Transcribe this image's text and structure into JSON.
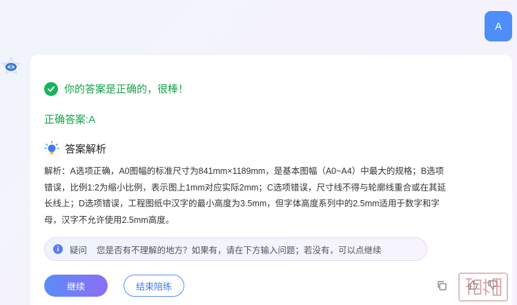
{
  "user": {
    "avatar_letter": "A",
    "accent": "#4d8ef8"
  },
  "result": {
    "message": "你的答案是正确的，很棒！",
    "correct_answer": "正确答案:A",
    "color": "#16a34a"
  },
  "analysis": {
    "title": "答案解析",
    "lines": [
      "解析：A选项正确，A0图幅的标准尺寸为841mm×1189mm，是基本图幅（A0~A4）中最大的规格；B选项",
      "错误，比例1:2为缩小比例，表示图上1mm对应实际2mm；C选项错误，尺寸线不得与轮廓线重合或在其延",
      "长线上；D选项错误，工程图纸中汉字的最小高度为3.5mm，但字体高度系列中的2.5mm适用于数字和字",
      "母，汉字不允许使用2.5mm高度。"
    ]
  },
  "question_tip": {
    "label": "疑问",
    "text": "您是否有不理解的地方？如果有，请在下方输入问题；若没有，可以点继续"
  },
  "actions": {
    "continue_label": "继续",
    "end_label": "结束陪练"
  },
  "icons": {
    "check": "check-circle-icon",
    "bulb": "lightbulb-icon",
    "info": "info-icon",
    "copy": "copy-icon",
    "like": "thumbs-up-icon",
    "dislike": "thumbs-down-icon"
  }
}
